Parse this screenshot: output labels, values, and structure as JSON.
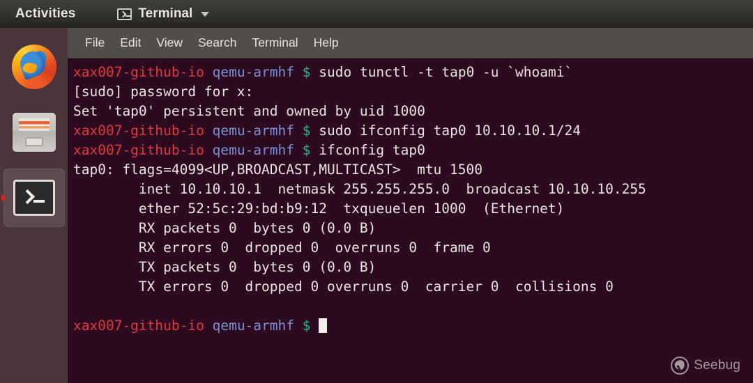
{
  "topbar": {
    "activities_label": "Activities",
    "app_icon": "terminal-icon",
    "app_name": "Terminal",
    "dropdown_icon": "chevron-down-icon"
  },
  "dock": {
    "items": [
      {
        "name": "firefox",
        "label": "Firefox",
        "active": false
      },
      {
        "name": "files",
        "label": "Files",
        "active": false
      },
      {
        "name": "terminal",
        "label": "Terminal",
        "active": true
      }
    ]
  },
  "terminal": {
    "menus": [
      "File",
      "Edit",
      "View",
      "Search",
      "Terminal",
      "Help"
    ],
    "prompt": {
      "host": "xax007-github-io",
      "dir": "qemu-armhf",
      "symbol": "$"
    },
    "lines": [
      {
        "type": "prompt",
        "command": "sudo tunctl -t tap0 -u `whoami`"
      },
      {
        "type": "output",
        "text": "[sudo] password for x:"
      },
      {
        "type": "output",
        "text": "Set 'tap0' persistent and owned by uid 1000"
      },
      {
        "type": "prompt",
        "command": "sudo ifconfig tap0 10.10.10.1/24"
      },
      {
        "type": "prompt",
        "command": "ifconfig tap0"
      },
      {
        "type": "output",
        "text": "tap0: flags=4099<UP,BROADCAST,MULTICAST>  mtu 1500"
      },
      {
        "type": "output",
        "text": "        inet 10.10.10.1  netmask 255.255.255.0  broadcast 10.10.10.255"
      },
      {
        "type": "output",
        "text": "        ether 52:5c:29:bd:b9:12  txqueuelen 1000  (Ethernet)"
      },
      {
        "type": "output",
        "text": "        RX packets 0  bytes 0 (0.0 B)"
      },
      {
        "type": "output",
        "text": "        RX errors 0  dropped 0  overruns 0  frame 0"
      },
      {
        "type": "output",
        "text": "        TX packets 0  bytes 0 (0.0 B)"
      },
      {
        "type": "output",
        "text": "        TX errors 0  dropped 0 overruns 0  carrier 0  collisions 0"
      },
      {
        "type": "output",
        "text": ""
      },
      {
        "type": "prompt",
        "command": "",
        "cursor": true
      }
    ]
  },
  "watermark": {
    "text": "Seebug",
    "icon": "seebug-logo-icon"
  },
  "colors": {
    "terminal_bg": "#2c0a1f",
    "topbar_bg": "#393732",
    "menubar_bg": "#514d48",
    "dock_bg": "#4b363c",
    "prompt_host": "#e0393c",
    "prompt_dir": "#7b8fd4",
    "prompt_symbol": "#27b98d",
    "output_text": "#e7e2de",
    "active_indicator": "#e02020"
  }
}
